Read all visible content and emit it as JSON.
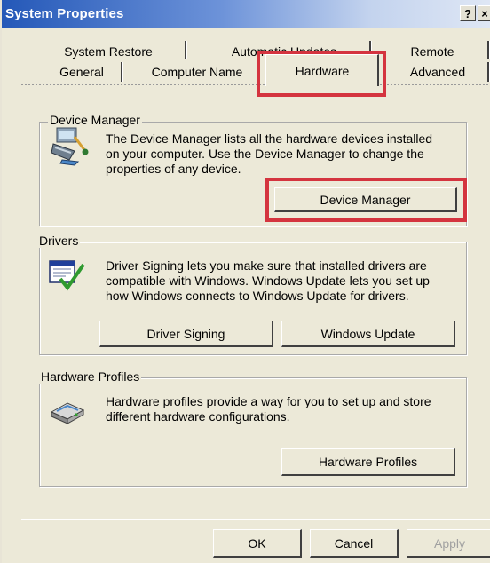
{
  "window": {
    "title": "System Properties",
    "help_label": "?",
    "close_label": "×"
  },
  "tabs": {
    "back_row": [
      "System Restore",
      "Automatic Updates",
      "Remote"
    ],
    "front_row": [
      "General",
      "Computer Name",
      "Hardware",
      "Advanced"
    ],
    "selected": "Hardware"
  },
  "device_manager": {
    "group_label": "Device Manager",
    "description_lines": [
      "The Device Manager lists all the hardware devices installed",
      "on your computer. Use the Device Manager to change the",
      "properties of any device."
    ],
    "button_label": "Device Manager",
    "icon": "device-manager-icon"
  },
  "drivers": {
    "group_label": "Drivers",
    "description_lines": [
      "Driver Signing lets you make sure that installed drivers are",
      "compatible with Windows. Windows Update lets you set up",
      "how Windows connects to Windows Update for drivers."
    ],
    "driver_signing_label": "Driver Signing",
    "windows_update_label": "Windows Update",
    "icon": "driver-signing-icon"
  },
  "hardware_profiles": {
    "group_label": "Hardware Profiles",
    "description_lines": [
      "Hardware profiles provide a way for you to set up and store",
      "different hardware configurations."
    ],
    "button_label": "Hardware Profiles",
    "icon": "hardware-profiles-icon"
  },
  "footer": {
    "ok_label": "OK",
    "cancel_label": "Cancel",
    "apply_label": "Apply"
  },
  "colors": {
    "highlight": "#d4343f",
    "dialog_bg": "#ece9d8",
    "titlebar_start": "#2458b8"
  }
}
